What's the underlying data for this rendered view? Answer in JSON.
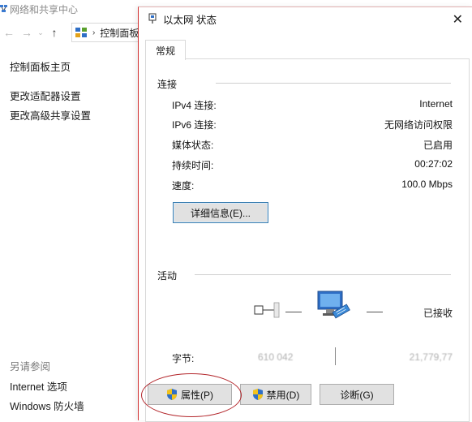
{
  "background": {
    "window_title": "网络和共享中心",
    "address_text": "控制面板",
    "sidebar": {
      "home": "控制面板主页",
      "links": [
        "更改适配器设置",
        "更改高级共享设置"
      ]
    },
    "see_also": {
      "label": "另请参阅",
      "links": [
        "Internet 选项",
        "Windows 防火墙"
      ]
    }
  },
  "dialog": {
    "title": "以太网 状态",
    "tab_label": "常规",
    "connection": {
      "heading": "连接",
      "rows": [
        {
          "label": "IPv4 连接:",
          "value": "Internet"
        },
        {
          "label": "IPv6 连接:",
          "value": "无网络访问权限"
        },
        {
          "label": "媒体状态:",
          "value": "已启用"
        },
        {
          "label": "持续时间:",
          "value": "00:27:02"
        },
        {
          "label": "速度:",
          "value": "100.0 Mbps"
        }
      ],
      "details_button": "详细信息(E)..."
    },
    "activity": {
      "heading": "活动",
      "received_label": "已接收",
      "bytes_label": "字节:",
      "bytes_sent": "610 042",
      "bytes_received": "21,779,77"
    },
    "buttons": {
      "properties": "属性(P)",
      "disable": "禁用(D)",
      "diagnose": "诊断(G)"
    }
  },
  "colors": {
    "highlight_circle": "#b3262b",
    "shield_blue": "#2f6fc6",
    "shield_yellow": "#f2c21b"
  }
}
